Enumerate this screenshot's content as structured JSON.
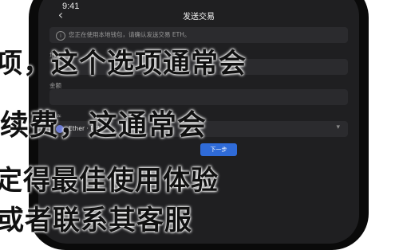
{
  "status": {
    "time": "9:41"
  },
  "nav": {
    "title": "发送交易",
    "back_label": "‹"
  },
  "info": {
    "icon_glyph": "i",
    "text": "您正在使用本地钱包，请确认发送交易 ETH。"
  },
  "fields": {
    "address_label": "地址",
    "amount_label": "金额",
    "asset_label": "资产",
    "asset_value": "Ether · ETH",
    "asset_chevron": "▾"
  },
  "actions": {
    "next_label": "下一步"
  },
  "overlay": {
    "line1": "项，这个选项通常会",
    "line2": "续费，这通常会",
    "line3": "定得最佳使用体验",
    "line4": "或者联系其客服"
  },
  "colors": {
    "accent": "#2f6bd8",
    "screen_bg": "#1f1f21",
    "field_bg": "#2b2b2e"
  }
}
